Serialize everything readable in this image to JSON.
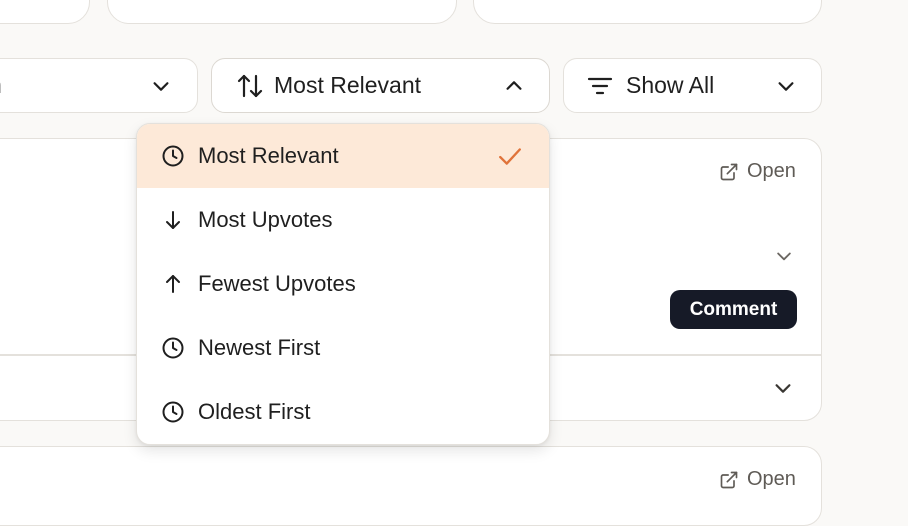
{
  "filters": {
    "left_partial_label": "n",
    "sort": {
      "label": "Most Relevant"
    },
    "show": {
      "label": "Show All"
    }
  },
  "sort_menu": {
    "items": [
      {
        "label": "Most Relevant",
        "icon": "clock-icon",
        "selected": true
      },
      {
        "label": "Most Upvotes",
        "icon": "arrow-down-icon",
        "selected": false
      },
      {
        "label": "Fewest Upvotes",
        "icon": "arrow-up-icon",
        "selected": false
      },
      {
        "label": "Newest First",
        "icon": "clock-icon",
        "selected": false
      },
      {
        "label": "Oldest First",
        "icon": "clock-icon",
        "selected": false
      }
    ]
  },
  "post": {
    "open_label": "Open",
    "comment_label": "Comment"
  },
  "post2": {
    "open_label": "Open"
  },
  "colors": {
    "accent": "#e0733a",
    "selected_bg": "#fde9d8",
    "comment_bg": "#161a27"
  }
}
